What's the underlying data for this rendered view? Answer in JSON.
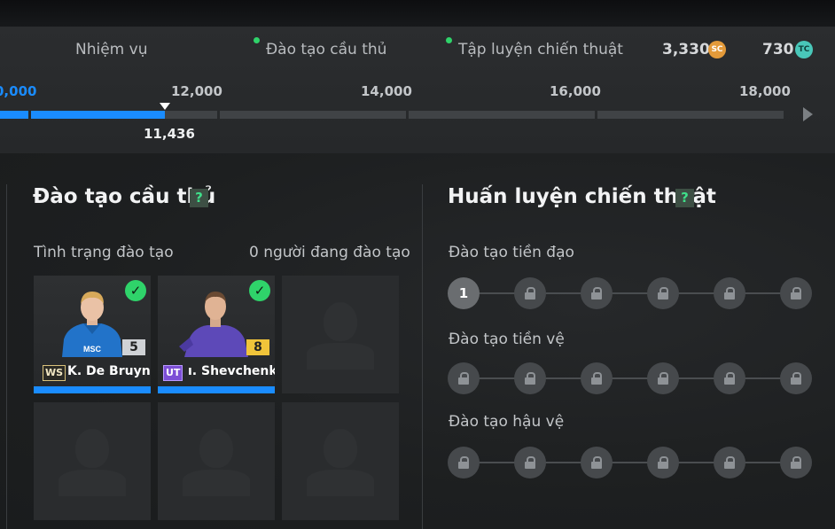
{
  "nav": {
    "tabs": [
      {
        "label": "Nhiệm vụ",
        "dot": false
      },
      {
        "label": "Đào tạo cầu thủ",
        "dot": true
      },
      {
        "label": "Tập luyện chiến thuật",
        "dot": true
      }
    ]
  },
  "currencies": [
    {
      "value": "3,330",
      "icon": "SC",
      "color": "#e39a3a"
    },
    {
      "value": "730",
      "icon": "TC",
      "color": "#49c7b9"
    }
  ],
  "progress": {
    "ticks": [
      "0,000",
      "12,000",
      "14,000",
      "16,000",
      "18,000"
    ],
    "current_label": "11,436",
    "current": 11436,
    "accent": "#1a8cff"
  },
  "player_training": {
    "title": "Đào tạo cầu thủ",
    "help": "?",
    "status_label": "Tình trạng đào tạo",
    "count_label": "0 người đang đào tạo",
    "players": [
      {
        "name": "K. De Bruyne",
        "badge": "WS",
        "rating": "5",
        "jersey": "#2273c9",
        "trained": true
      },
      {
        "name": "ı. Shevchenko",
        "badge": "UT",
        "rating": "8",
        "jersey": "#5d49b8",
        "trained": true
      }
    ]
  },
  "tactical_training": {
    "title": "Huấn luyện chiến thuật",
    "help": "?",
    "rows": [
      {
        "label": "Đào tạo tiền đạo",
        "first_node": "1"
      },
      {
        "label": "Đào tạo tiền vệ",
        "first_node": ""
      },
      {
        "label": "Đào tạo hậu vệ",
        "first_node": ""
      }
    ]
  }
}
